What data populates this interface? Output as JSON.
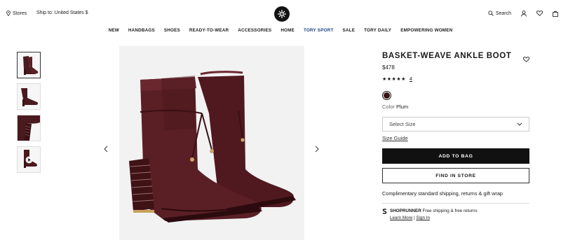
{
  "header": {
    "stores_label": "Stores",
    "ship_label": "Ship to: United States $",
    "search_label": "Search"
  },
  "nav": {
    "items": [
      "NEW",
      "HANDBAGS",
      "SHOES",
      "READY-TO-WEAR",
      "ACCESSORIES",
      "HOME",
      "TORY SPORT",
      "SALE",
      "TORY DAILY",
      "EMPOWERING WOMEN"
    ]
  },
  "product": {
    "title": "BASKET-WEAVE ANKLE BOOT",
    "price": "$478",
    "rating_stars": "★★★★★",
    "rating": 4.5,
    "review_count": "4",
    "color_label": "Color",
    "color_value": "Plum",
    "swatch_color": "#3a1216",
    "size_placeholder": "Select Size",
    "size_guide": "Size Guide",
    "add_to_bag": "ADD TO BAG",
    "find_in_store": "FIND IN STORE",
    "shipping_note": "Complimentary standard shipping, returns & gift wrap",
    "shoprunner": {
      "brand": "SHOPRUNNER",
      "text": "Free shipping & free returns",
      "learn_more": "Learn More",
      "sep": "|",
      "sign_in": "Sign In"
    }
  },
  "gallery": {
    "thumbnail_count": 4,
    "active_index": 0
  },
  "colors": {
    "accent_sport": "#1d3f85",
    "boot": "#4a1a1e",
    "button_dark": "#111111"
  }
}
